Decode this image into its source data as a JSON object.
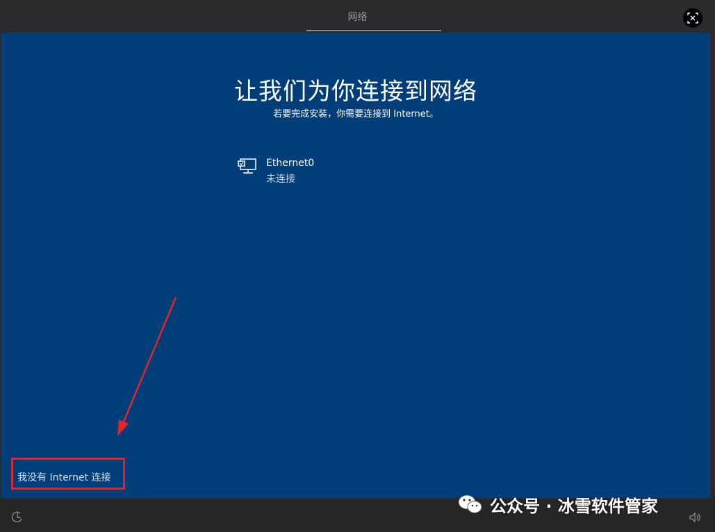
{
  "topbar": {
    "title": "网络",
    "close_icon": "close-x-icon"
  },
  "main": {
    "heading": "让我们为你连接到网络",
    "subheading": "若要完成安装，你需要连接到 Internet。",
    "network": {
      "icon": "ethernet-icon",
      "name": "Ethernet0",
      "status": "未连接"
    },
    "no_internet_link": "我没有 Internet 连接"
  },
  "bottombar": {
    "left_icon": "accessibility-icon",
    "right_icon": "volume-icon"
  },
  "watermark": {
    "icon": "wechat-icon",
    "text": "公众号 · 冰雪软件管家"
  },
  "colors": {
    "background": "#003e7a",
    "annotation_red": "#e0262b"
  }
}
